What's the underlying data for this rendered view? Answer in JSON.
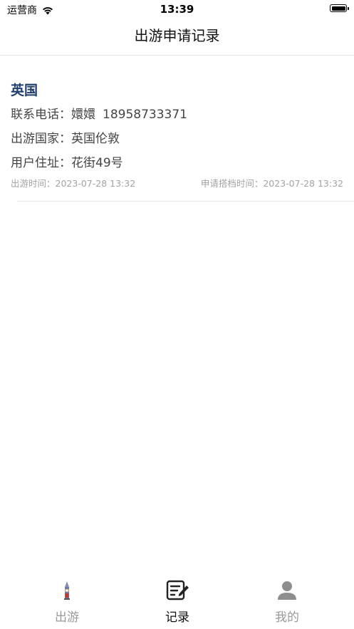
{
  "status_bar": {
    "carrier": "运营商",
    "time": "13:39"
  },
  "nav": {
    "title": "出游申请记录"
  },
  "records": [
    {
      "title": "英国",
      "phone_label": "联系电话：",
      "contact_name": "嬛嬛",
      "phone": "18958733371",
      "country_label": "出游国家：",
      "country": "英国伦敦",
      "address_label": "用户住址：",
      "address": "花街49号",
      "travel_time_label": "出游时间：",
      "travel_time": "2023-07-28 13:32",
      "apply_time_label": "申请搭档时间：",
      "apply_time": "2023-07-28 13:32"
    }
  ],
  "tab_bar": {
    "active_tab": "记录",
    "tabs": [
      {
        "label": "出游",
        "icon": "big-ben-icon"
      },
      {
        "label": "记录",
        "icon": "edit-note-icon"
      },
      {
        "label": "我的",
        "icon": "person-icon"
      }
    ]
  }
}
